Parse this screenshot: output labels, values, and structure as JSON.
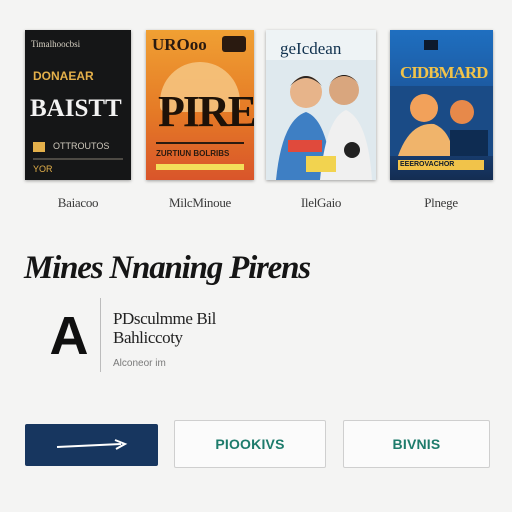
{
  "covers": [
    {
      "top_text": "Timalhoocbsi",
      "mid_text": "DONAEAR",
      "big_title": "BAISTT",
      "small_text": "OTTROUTOS",
      "footer_text": "YOR"
    },
    {
      "top_text": "UROoo",
      "big_title": "PIRES",
      "footer_text": "ZURTIUN BOLRIBS"
    },
    {
      "top_text": "geIcdean"
    },
    {
      "top_text": "CIDBMARD",
      "footer_text": "EEEROVACHOR"
    }
  ],
  "captions": [
    "Baiacoo",
    "MilcMinoue",
    "IlelGaio",
    "Plnege"
  ],
  "headline": "Mines Nnaning Pirens",
  "card": {
    "avatar_letter": "A",
    "title": "PDsculmme Bil Bahliccoty",
    "meta": "Alconeor im"
  },
  "buttons": {
    "primary_label": "",
    "primary_icon": "arrow-right-icon",
    "secondary_label": "PIOOKIVS",
    "tertiary_label": "BIVNIS"
  },
  "colors": {
    "background": "#f4f4f3",
    "primary_button": "#17365f",
    "outline_text": "#1d7b6b"
  }
}
